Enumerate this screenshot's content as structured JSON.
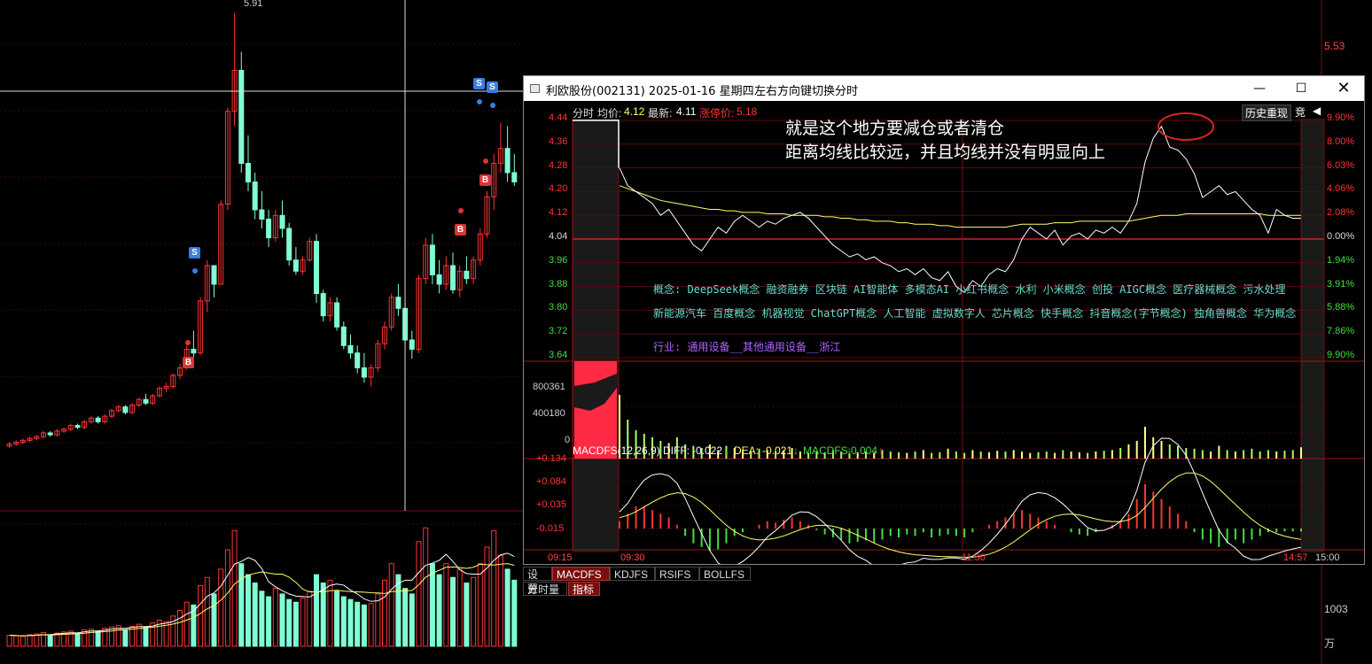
{
  "colors": {
    "up": "#ff3333",
    "down": "#7fffd4",
    "axis_red": "#cc2222",
    "yellow": "#ffff66",
    "green": "#44dd44",
    "cyan": "#66ddcc",
    "purple": "#b060ff",
    "white": "#ffffff"
  },
  "background_chart": {
    "price_labels": {
      "high": "5.91",
      "right_top": "5.53"
    },
    "volume_right_label": "1003",
    "volume_unit": "万",
    "candles": [
      [
        3.58,
        3.6,
        3.57,
        3.59
      ],
      [
        3.59,
        3.61,
        3.58,
        3.6
      ],
      [
        3.6,
        3.62,
        3.59,
        3.61
      ],
      [
        3.61,
        3.63,
        3.6,
        3.62
      ],
      [
        3.62,
        3.64,
        3.61,
        3.63
      ],
      [
        3.63,
        3.66,
        3.62,
        3.65
      ],
      [
        3.65,
        3.66,
        3.63,
        3.64
      ],
      [
        3.64,
        3.67,
        3.63,
        3.66
      ],
      [
        3.66,
        3.68,
        3.65,
        3.67
      ],
      [
        3.67,
        3.7,
        3.66,
        3.69
      ],
      [
        3.69,
        3.7,
        3.67,
        3.68
      ],
      [
        3.68,
        3.72,
        3.67,
        3.71
      ],
      [
        3.71,
        3.74,
        3.7,
        3.73
      ],
      [
        3.73,
        3.74,
        3.7,
        3.71
      ],
      [
        3.71,
        3.75,
        3.7,
        3.74
      ],
      [
        3.74,
        3.78,
        3.73,
        3.77
      ],
      [
        3.77,
        3.8,
        3.76,
        3.79
      ],
      [
        3.79,
        3.8,
        3.75,
        3.76
      ],
      [
        3.76,
        3.81,
        3.75,
        3.8
      ],
      [
        3.8,
        3.84,
        3.79,
        3.83
      ],
      [
        3.83,
        3.86,
        3.8,
        3.81
      ],
      [
        3.81,
        3.86,
        3.8,
        3.85
      ],
      [
        3.85,
        3.9,
        3.84,
        3.89
      ],
      [
        3.89,
        3.92,
        3.87,
        3.9
      ],
      [
        3.9,
        3.97,
        3.89,
        3.96
      ],
      [
        3.96,
        4.02,
        3.94,
        4.0
      ],
      [
        4.0,
        4.12,
        3.99,
        4.1
      ],
      [
        4.1,
        4.2,
        4.05,
        4.08
      ],
      [
        4.08,
        4.38,
        4.07,
        4.36
      ],
      [
        4.36,
        4.58,
        4.3,
        4.55
      ],
      [
        4.55,
        4.55,
        4.38,
        4.45
      ],
      [
        4.45,
        4.9,
        4.45,
        4.88
      ],
      [
        4.88,
        5.4,
        4.85,
        5.38
      ],
      [
        5.38,
        5.91,
        5.3,
        5.6
      ],
      [
        5.6,
        5.7,
        5.05,
        5.1
      ],
      [
        5.1,
        5.25,
        4.95,
        5.0
      ],
      [
        5.0,
        5.05,
        4.8,
        4.85
      ],
      [
        4.85,
        4.95,
        4.75,
        4.8
      ],
      [
        4.8,
        4.85,
        4.65,
        4.7
      ],
      [
        4.7,
        4.85,
        4.68,
        4.82
      ],
      [
        4.82,
        4.9,
        4.7,
        4.75
      ],
      [
        4.75,
        4.78,
        4.55,
        4.58
      ],
      [
        4.58,
        4.65,
        4.5,
        4.52
      ],
      [
        4.52,
        4.6,
        4.5,
        4.58
      ],
      [
        4.58,
        4.7,
        4.57,
        4.68
      ],
      [
        4.68,
        4.72,
        4.35,
        4.4
      ],
      [
        4.4,
        4.42,
        4.25,
        4.28
      ],
      [
        4.28,
        4.38,
        4.25,
        4.35
      ],
      [
        4.35,
        4.38,
        4.2,
        4.22
      ],
      [
        4.22,
        4.25,
        4.1,
        4.12
      ],
      [
        4.12,
        4.18,
        4.05,
        4.08
      ],
      [
        4.08,
        4.12,
        3.97,
        4.0
      ],
      [
        4.0,
        4.08,
        3.92,
        3.95
      ],
      [
        3.95,
        4.02,
        3.9,
        4.0
      ],
      [
        4.0,
        4.15,
        3.98,
        4.13
      ],
      [
        4.13,
        4.25,
        4.1,
        4.22
      ],
      [
        4.22,
        4.4,
        4.2,
        4.38
      ],
      [
        4.38,
        4.45,
        4.28,
        4.32
      ],
      [
        4.32,
        4.35,
        4.12,
        4.15
      ],
      [
        4.15,
        4.2,
        4.05,
        4.1
      ],
      [
        4.1,
        4.5,
        4.08,
        4.48
      ],
      [
        4.48,
        4.7,
        4.45,
        4.66
      ],
      [
        4.66,
        4.72,
        4.45,
        4.5
      ],
      [
        4.5,
        4.58,
        4.4,
        4.45
      ],
      [
        4.45,
        4.6,
        4.42,
        4.55
      ],
      [
        4.55,
        4.62,
        4.4,
        4.42
      ],
      [
        4.42,
        4.55,
        4.38,
        4.52
      ],
      [
        4.52,
        4.6,
        4.45,
        4.48
      ],
      [
        4.48,
        4.6,
        4.45,
        4.58
      ],
      [
        4.58,
        4.75,
        4.55,
        4.72
      ],
      [
        4.72,
        4.95,
        4.7,
        4.92
      ],
      [
        4.92,
        5.15,
        4.85,
        5.1
      ],
      [
        5.1,
        5.32,
        5.05,
        5.18
      ],
      [
        5.18,
        5.3,
        5.0,
        5.05
      ],
      [
        5.05,
        5.15,
        4.98,
        5.0
      ]
    ],
    "volumes": [
      40,
      38,
      36,
      42,
      45,
      50,
      40,
      48,
      52,
      55,
      48,
      60,
      62,
      55,
      66,
      70,
      75,
      60,
      72,
      80,
      70,
      85,
      95,
      90,
      110,
      130,
      160,
      150,
      220,
      250,
      190,
      280,
      350,
      420,
      300,
      260,
      230,
      200,
      180,
      210,
      190,
      170,
      160,
      175,
      200,
      260,
      230,
      240,
      200,
      180,
      170,
      160,
      150,
      155,
      190,
      240,
      300,
      260,
      210,
      190,
      380,
      430,
      300,
      260,
      300,
      250,
      280,
      230,
      250,
      300,
      360,
      420,
      330,
      280,
      240
    ]
  },
  "popup": {
    "title": "利欧股份(002131) 2025-01-16 星期四",
    "hint": "左右方向键切换分时",
    "minimize_icon": "minimize-icon",
    "maximize_icon": "maximize-icon",
    "close_icon": "close-icon",
    "header": {
      "label_fenshi": "分时",
      "label_avg": "均价:",
      "avg_value": "4.12",
      "label_latest": "最新:",
      "latest_value": "4.11",
      "label_limit": "涨停价:",
      "limit_value": "5.18",
      "history_button": "历史重现",
      "bid_button": "竞"
    },
    "annotation": {
      "line1": "就是这个地方要减仓或者清仓",
      "line2": "距离均线比较远，并且均线并没有明显向上"
    },
    "price_axis": {
      "left": [
        "4.44",
        "4.36",
        "4.28",
        "4.20",
        "4.12",
        "4.04",
        "3.96",
        "3.88",
        "3.80",
        "3.72",
        "3.64"
      ],
      "right": [
        "9.90%",
        "8.00%",
        "6.03%",
        "4.06%",
        "2.08%",
        "0.00%",
        "1.94%",
        "3.91%",
        "5.88%",
        "7.86%",
        "9.90%"
      ]
    },
    "concepts": {
      "line1": "概念: DeepSeek概念 融资融券 区块链 AI智能体 多模态AI 小红书概念 水利 小米概念 创投 AIGC概念 医疗器械概念 污水处理",
      "line2": "新能源汽车 百度概念 机器视觉 ChatGPT概念 人工智能 虚拟数字人 芯片概念 快手概念 抖音概念(字节概念) 独角兽概念 华为概念",
      "industry": "行业: 通用设备__其他通用设备__浙江"
    },
    "volume_axis": [
      "800361",
      "400180",
      "0"
    ],
    "macd": {
      "label": "MACDFS(12,26,9)",
      "diff_label": "DIFF:",
      "diff_value": "-0.022",
      "dea_label": "DEA:",
      "dea_value": "-0.021",
      "macd_label": "MACDFS:",
      "macd_value": "-0.004",
      "down_arrow": "↓",
      "up_arrow": "↑",
      "axis": [
        "+0.134",
        "+0.084",
        "+0.035",
        "-0.015"
      ]
    },
    "time_axis": [
      "09:15",
      "09:30",
      "11:30",
      "14:57",
      "15:00"
    ],
    "indicator_tabs": [
      "设置",
      "MACDFS",
      "KDJFS",
      "RSIFS",
      "BOLLFS"
    ],
    "sub_tabs": [
      "分时量",
      "指标"
    ],
    "intraday_price": [
      4.28,
      4.22,
      4.2,
      4.18,
      4.16,
      4.12,
      4.14,
      4.1,
      4.06,
      4.02,
      4.0,
      4.04,
      4.08,
      4.06,
      4.1,
      4.12,
      4.1,
      4.08,
      4.1,
      4.09,
      4.11,
      4.12,
      4.13,
      4.11,
      4.08,
      4.05,
      4.02,
      4.0,
      3.98,
      3.99,
      3.97,
      3.98,
      3.96,
      3.95,
      3.93,
      3.94,
      3.92,
      3.94,
      3.91,
      3.9,
      3.93,
      3.88,
      3.86,
      3.9,
      3.88,
      3.92,
      3.94,
      3.93,
      3.97,
      4.04,
      4.08,
      4.06,
      4.04,
      4.07,
      4.02,
      4.05,
      4.06,
      4.04,
      4.07,
      4.06,
      4.08,
      4.06,
      4.1,
      4.16,
      4.3,
      4.38,
      4.42,
      4.35,
      4.34,
      4.31,
      4.26,
      4.18,
      4.2,
      4.22,
      4.19,
      4.2,
      4.17,
      4.14,
      4.12,
      4.06,
      4.14,
      4.12,
      4.11,
      4.11
    ],
    "intraday_avg": [
      4.22,
      4.21,
      4.2,
      4.19,
      4.18,
      4.17,
      4.165,
      4.16,
      4.155,
      4.15,
      4.145,
      4.14,
      4.14,
      4.135,
      4.135,
      4.13,
      4.13,
      4.13,
      4.125,
      4.125,
      4.125,
      4.12,
      4.12,
      4.12,
      4.12,
      4.115,
      4.115,
      4.11,
      4.11,
      4.105,
      4.105,
      4.1,
      4.1,
      4.1,
      4.095,
      4.095,
      4.09,
      4.09,
      4.09,
      4.085,
      4.085,
      4.08,
      4.08,
      4.08,
      4.08,
      4.08,
      4.08,
      4.08,
      4.085,
      4.09,
      4.09,
      4.09,
      4.09,
      4.095,
      4.095,
      4.095,
      4.1,
      4.1,
      4.1,
      4.1,
      4.1,
      4.1,
      4.1,
      4.105,
      4.11,
      4.115,
      4.12,
      4.12,
      4.12,
      4.125,
      4.125,
      4.125,
      4.125,
      4.125,
      4.125,
      4.125,
      4.125,
      4.125,
      4.125,
      4.12,
      4.12,
      4.12,
      4.12,
      4.12
    ],
    "intraday_volume": [
      90,
      55,
      40,
      35,
      30,
      25,
      22,
      30,
      20,
      18,
      15,
      20,
      12,
      18,
      15,
      12,
      10,
      14,
      12,
      10,
      12,
      15,
      10,
      8,
      10,
      9,
      12,
      10,
      8,
      9,
      10,
      8,
      12,
      10,
      9,
      8,
      10,
      12,
      8,
      9,
      14,
      10,
      8,
      12,
      10,
      9,
      11,
      10,
      12,
      10,
      8,
      9,
      10,
      8,
      12,
      10,
      9,
      8,
      10,
      11,
      12,
      15,
      20,
      25,
      45,
      30,
      25,
      20,
      18,
      15,
      14,
      12,
      10,
      18,
      12,
      10,
      12,
      14,
      10,
      12,
      10,
      11,
      12,
      16
    ],
    "macd_values": [
      0.01,
      0.02,
      0.03,
      0.03,
      0.025,
      0.02,
      0.015,
      0.005,
      -0.01,
      -0.02,
      -0.025,
      -0.03,
      -0.028,
      -0.02,
      -0.01,
      -0.005,
      0.0,
      0.005,
      0.01,
      0.008,
      0.012,
      0.015,
      0.01,
      0.005,
      -0.002,
      -0.008,
      -0.012,
      -0.015,
      -0.02,
      -0.018,
      -0.016,
      -0.02,
      -0.015,
      -0.01,
      -0.012,
      -0.008,
      -0.01,
      -0.005,
      -0.012,
      -0.01,
      -0.008,
      -0.01,
      -0.012,
      -0.005,
      0.0,
      0.005,
      0.01,
      0.015,
      0.02,
      0.025,
      0.02,
      0.015,
      0.01,
      0.005,
      0.0,
      -0.005,
      -0.008,
      -0.01,
      -0.005,
      0.0,
      0.005,
      0.01,
      0.02,
      0.04,
      0.06,
      0.05,
      0.04,
      0.03,
      0.02,
      0.01,
      -0.005,
      -0.015,
      -0.02,
      -0.025,
      -0.02,
      -0.015,
      -0.02,
      -0.015,
      -0.01,
      -0.005,
      -0.005,
      -0.004,
      -0.004,
      -0.004
    ]
  }
}
